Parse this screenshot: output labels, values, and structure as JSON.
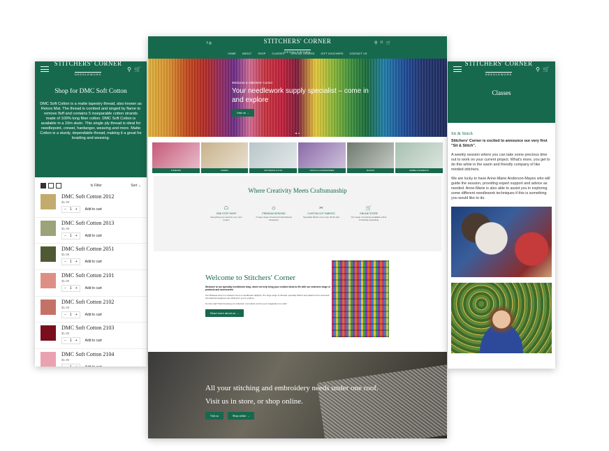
{
  "brand": {
    "name": "STITCHERS' CORNER",
    "sub": "NEEDLEWORK"
  },
  "colors": {
    "brand_green": "#17694d"
  },
  "left": {
    "heading": "Shop for DMC Soft Cotton",
    "description": "DMC Soft Cotton is a matte tapestry thread, also known as Retors Mat. The thread is combed and singed by flame to remove fluff and contains 5 inseparable cotton strands made of 100% long fiber cotton. DMC Soft Cotton is available in a 10m skein. This single ply thread is ideal for needlepoint, crewel, hardanger, weaving and more. Matte Cotton is a sturdy, dependable thread, making it a great for braiding and weaving.",
    "filter": "Filter",
    "sort": "Sort",
    "products": [
      {
        "name": "DMC Soft Cotton 2012",
        "price": "$1.90",
        "qty": "1",
        "add": "Add to cart",
        "color": "#c2ab6c"
      },
      {
        "name": "DMC Soft Cotton 2013",
        "price": "$1.90",
        "qty": "1",
        "add": "Add to cart",
        "color": "#9aa37a"
      },
      {
        "name": "DMC Soft Cotton 2051",
        "price": "$1.90",
        "qty": "1",
        "add": "Add to cart",
        "color": "#4f5a34"
      },
      {
        "name": "DMC Soft Cotton 2101",
        "price": "$1.90",
        "qty": "1",
        "add": "Add to cart",
        "color": "#de8f84"
      },
      {
        "name": "DMC Soft Cotton 2102",
        "price": "$1.90",
        "qty": "1",
        "add": "Add to cart",
        "color": "#c57266"
      },
      {
        "name": "DMC Soft Cotton 2103",
        "price": "$1.90",
        "qty": "1",
        "add": "Add to cart",
        "color": "#7a0e1c"
      },
      {
        "name": "DMC Soft Cotton 2104",
        "price": "$1.90",
        "qty": "1",
        "add": "Add to cart",
        "color": "#eaa2b0"
      }
    ]
  },
  "center": {
    "nav": [
      "HOME",
      "ABOUT",
      "SHOP",
      "CLASSES",
      "SPECIAL ORDERS",
      "GIFT VOUCHERS",
      "CONTACT US"
    ],
    "hero": {
      "eyebrow": "Welcome to Stitchers' Corner",
      "headline": "Your needlework supply specialist – come in and explore",
      "button": "Visit us →"
    },
    "categories": [
      {
        "label": "THREADS",
        "color": "#c65a7a"
      },
      {
        "label": "FABRIC",
        "color": "#c8b28c"
      },
      {
        "label": "PATTERNS & KITS",
        "color": "#b9c6c9"
      },
      {
        "label": "TOOLS & ACCESSORIES",
        "color": "#8a6aa8"
      },
      {
        "label": "BOOKS",
        "color": "#6f7a6e"
      },
      {
        "label": "EMBELLISHMENTS",
        "color": "#a8c0b0"
      }
    ],
    "craft": {
      "title": "Where Creativity Meets Craftsmanship",
      "features": [
        {
          "icon": "☖",
          "title": "ONE STOP SHOP",
          "desc": "Everything you need for your next project"
        },
        {
          "icon": "◇",
          "title": "PREMIUM DESIGNS",
          "desc": "A huge range of local and international Designers"
        },
        {
          "icon": "✂",
          "title": "CUSTOM CUT FABRICS",
          "desc": "Specialist fabrics cut to size off the bolt"
        },
        {
          "icon": "🛒",
          "title": "ONLINE STORE",
          "desc": "Our range of products available online constantly expanding"
        }
      ]
    },
    "welcome": {
      "title": "Welcome to Stitchers' Corner",
      "lead": "Welcome to our specialty needlework shop, where we help bring your creative ideas to life with our extensive range of products and accessories!",
      "p1": "Our Brassica shop is a treasure trove of needlework delights. Our huge range of threads, specialty fabrics and patterns from local and international designers are waiting for you to explore.",
      "p2": "So why wait? Start browsing our collection of products and let your imagination run wild!",
      "button": "Read more about us →"
    },
    "bottom": {
      "line1": "All your stitching and embroidery needs under one roof.",
      "line2": "Visit us in store, or shop online.",
      "btn1": "Visit us",
      "btn2": "Shop online →"
    }
  },
  "right": {
    "heading": "Classes",
    "section": "Sit & Stitch",
    "lead": "Stitchers' Corner is excited to announce our very first \"Sit & Stitch\".",
    "p1": "A weekly session where you can take some precious time out to work on your current project. What's more, you get to do this while in the warm and friendly company of like minded stitchers.",
    "p2": "We are lucky to have Anne-Marie Anderson-Mayes who will guide the session, providing expert support and advice as needed. Anne-Marie is also able to assist you in exploring some different needlework techniques if this is something you would like to do."
  }
}
